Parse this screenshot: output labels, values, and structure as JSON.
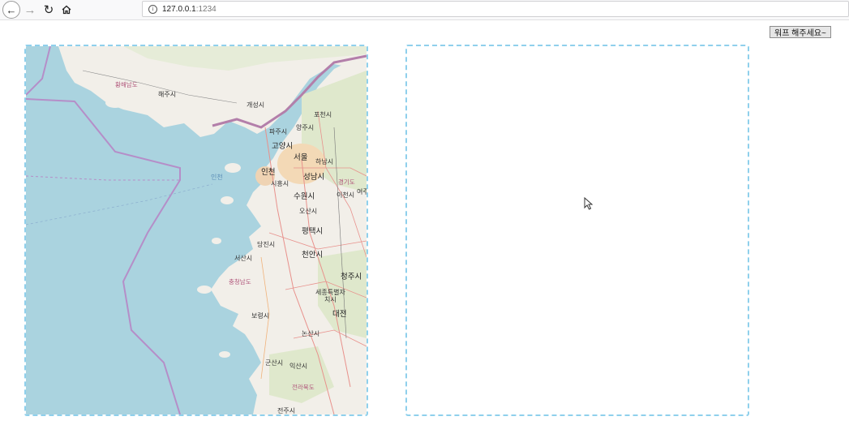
{
  "browser": {
    "url_host": "127.0.0.1",
    "url_port": ":1234",
    "back_icon": "arrow-left-icon",
    "forward_icon": "arrow-right-icon",
    "reload_icon": "reload-icon",
    "home_icon": "home-icon",
    "info_icon": "info-icon"
  },
  "toolbar": {
    "warp_button_label": "워프 해주세요~"
  },
  "map": {
    "labels": {
      "hwanghae": "황해남도",
      "haeju": "해주시",
      "kaesong": "개성시",
      "pocheon": "포천시",
      "paju": "파주시",
      "yangju": "양주시",
      "goyang": "고양시",
      "seoul": "서울",
      "hanam": "하남시",
      "incheon_sea": "인천",
      "incheon": "인천",
      "siheung": "시흥시",
      "seongnam": "성남시",
      "gyeonggi": "경기도",
      "icheon": "이천시",
      "yeoju": "여주",
      "suwon": "수원시",
      "osan": "오산시",
      "pyeongtaek": "평택시",
      "dangjin": "당진시",
      "seosan": "서산시",
      "cheonan": "천안시",
      "chungnam": "충청남도",
      "cheongju": "청주시",
      "sejong_1": "세종특별자",
      "sejong_2": "치시",
      "boryeong": "보령시",
      "daejeon": "대전",
      "nonsan": "논산시",
      "gunsan": "군산시",
      "iksan": "익산시",
      "jeonbuk": "전라북도",
      "jeonju": "전주시"
    }
  },
  "colors": {
    "panel_border": "#8fd0ec",
    "sea": "#aad3df",
    "land": "#f2efe9",
    "border_line": "#b58ec8"
  }
}
